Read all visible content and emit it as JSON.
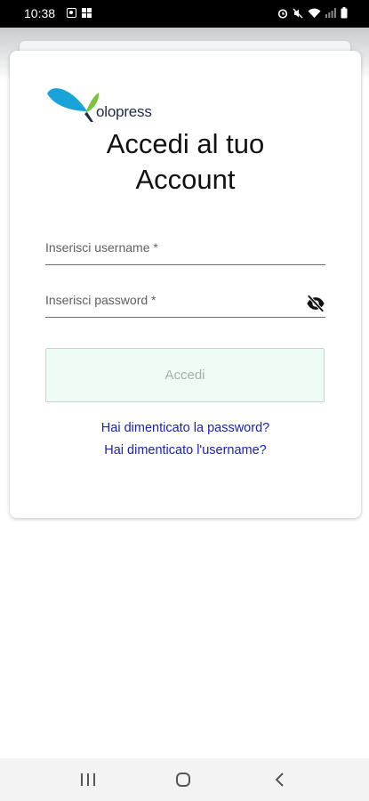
{
  "status_bar": {
    "time": "10:38",
    "icons": [
      "notification-icon",
      "gallery-icon",
      "alarm-icon",
      "mute-icon",
      "wifi-icon",
      "signal-icon",
      "battery-icon"
    ]
  },
  "logo": {
    "text": "olopress",
    "colors": {
      "leaf_left": "#1aa3d9",
      "leaf_right": "#7cc242"
    }
  },
  "login": {
    "title_line1": "Accedi al tuo",
    "title_line2": "Account",
    "username_label": "Inserisci username *",
    "password_label": "Inserisci password *",
    "submit_label": "Accedi",
    "forgot_password": "Hai dimenticato la password?",
    "forgot_username": "Hai dimenticato l'username?"
  },
  "navigation": {
    "buttons": [
      "recents-icon",
      "home-icon",
      "back-icon"
    ]
  },
  "colors": {
    "link": "#1a22b0",
    "button_bg": "#effbf5"
  }
}
